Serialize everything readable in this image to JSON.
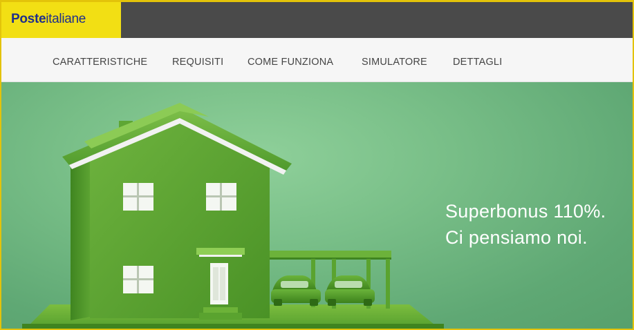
{
  "header": {
    "logo": {
      "part_bold": "Poste",
      "part_light": "italiane"
    },
    "colors": {
      "logo_background": "#f2df14",
      "logo_text": "#1f2f8c",
      "bar_background": "#4a4a4a"
    }
  },
  "nav": {
    "items": [
      {
        "label": "CARATTERISTICHE"
      },
      {
        "label": "REQUISITI"
      },
      {
        "label": "COME FUNZIONA"
      },
      {
        "label": "SIMULATORE"
      },
      {
        "label": "DETTAGLI"
      }
    ]
  },
  "hero": {
    "title_line1": "Superbonus 110%.",
    "title_line2": "Ci pensiamo noi.",
    "colors": {
      "background": "#79bf88",
      "grass": "#4f9a2c"
    },
    "illustration": "grass-covered-house-with-carport-and-two-cars"
  }
}
